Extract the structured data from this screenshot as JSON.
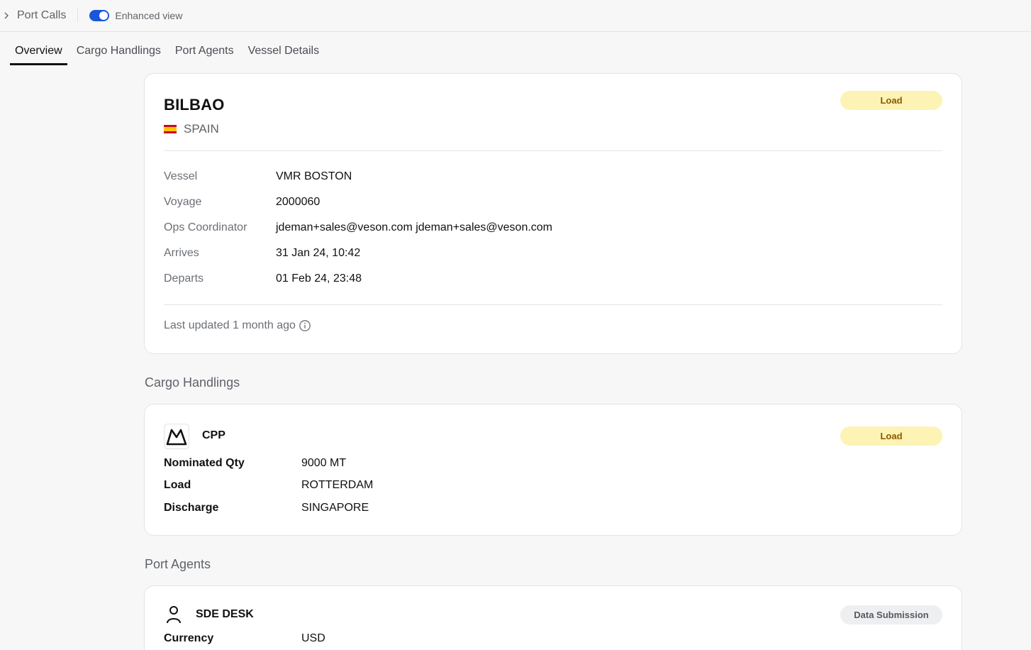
{
  "breadcrumb": {
    "label": "Port Calls"
  },
  "enhanced_view": {
    "label": "Enhanced view",
    "on": true
  },
  "tabs": [
    {
      "label": "Overview",
      "active": true
    },
    {
      "label": "Cargo Handlings",
      "active": false
    },
    {
      "label": "Port Agents",
      "active": false
    },
    {
      "label": "Vessel Details",
      "active": false
    }
  ],
  "port": {
    "name": "BILBAO",
    "country": "SPAIN",
    "badge": "Load",
    "fields": [
      {
        "key": "Vessel",
        "value": "VMR BOSTON"
      },
      {
        "key": "Voyage",
        "value": "2000060"
      },
      {
        "key": "Ops Coordinator",
        "value": "jdeman+sales@veson.com jdeman+sales@veson.com"
      },
      {
        "key": "Arrives",
        "value": "31 Jan 24, 10:42"
      },
      {
        "key": "Departs",
        "value": "01 Feb 24, 23:48"
      }
    ],
    "last_updated": "Last updated 1 month ago"
  },
  "cargo_section": {
    "title": "Cargo Handlings",
    "item": {
      "name": "CPP",
      "badge": "Load",
      "icon": "cargo-mountain-icon",
      "fields": [
        {
          "key": "Nominated Qty",
          "value": "9000 MT"
        },
        {
          "key": "Load",
          "value": "ROTTERDAM"
        },
        {
          "key": "Discharge",
          "value": "SINGAPORE"
        }
      ]
    }
  },
  "agents_section": {
    "title": "Port Agents",
    "item": {
      "name": "SDE DESK",
      "badge": "Data Submission",
      "icon": "person-icon",
      "fields": [
        {
          "key": "Currency",
          "value": "USD"
        }
      ]
    }
  },
  "colors": {
    "accent": "#1a56db",
    "load_badge_bg": "#fdf3b4",
    "load_badge_text": "#8a5a00",
    "gray_badge_bg": "#eeeff0"
  }
}
